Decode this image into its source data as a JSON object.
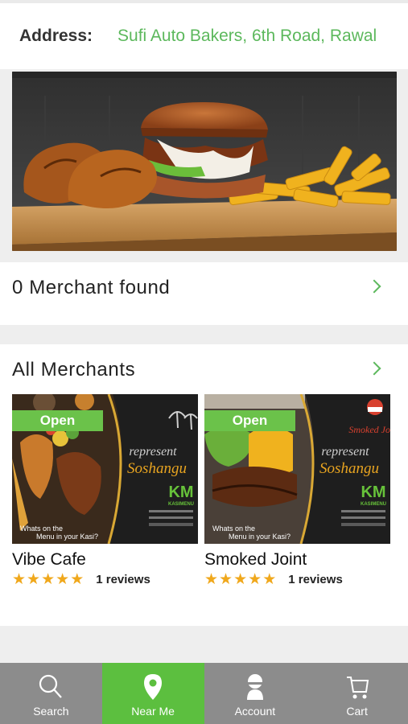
{
  "address": {
    "label": "Address:",
    "value": "Sufi Auto Bakers, 6th Road, Rawal"
  },
  "merchant_found": {
    "title": "0 Merchant found"
  },
  "all_merchants": {
    "title": "All Merchants",
    "cards": [
      {
        "status": "Open",
        "name": "Vibe Cafe",
        "rating": 5,
        "reviews": "1 reviews",
        "promo": {
          "line1": "represent",
          "line2": "Soshangu",
          "brand": "KASIMENU",
          "tag1": "Whats on the",
          "tag2": "Menu in your Kasi?"
        }
      },
      {
        "status": "Open",
        "name": "Smoked Joint",
        "rating": 5,
        "reviews": "1 reviews",
        "promo": {
          "line1": "represent",
          "line2": "Soshangu",
          "brand": "KASIMENU",
          "tag1": "Whats on the",
          "tag2": "Menu in your Kasi?",
          "logo_text": "Smoked Jo"
        }
      }
    ]
  },
  "nav": {
    "items": [
      {
        "label": "Search",
        "icon": "search-icon"
      },
      {
        "label": "Near Me",
        "icon": "location-pin-icon"
      },
      {
        "label": "Account",
        "icon": "user-icon"
      },
      {
        "label": "Cart",
        "icon": "cart-icon"
      }
    ]
  },
  "colors": {
    "accent": "#5cb85c",
    "nav_bg": "#8c8c8c",
    "nav_active": "#5cbf3f",
    "star": "#f0a81c"
  }
}
